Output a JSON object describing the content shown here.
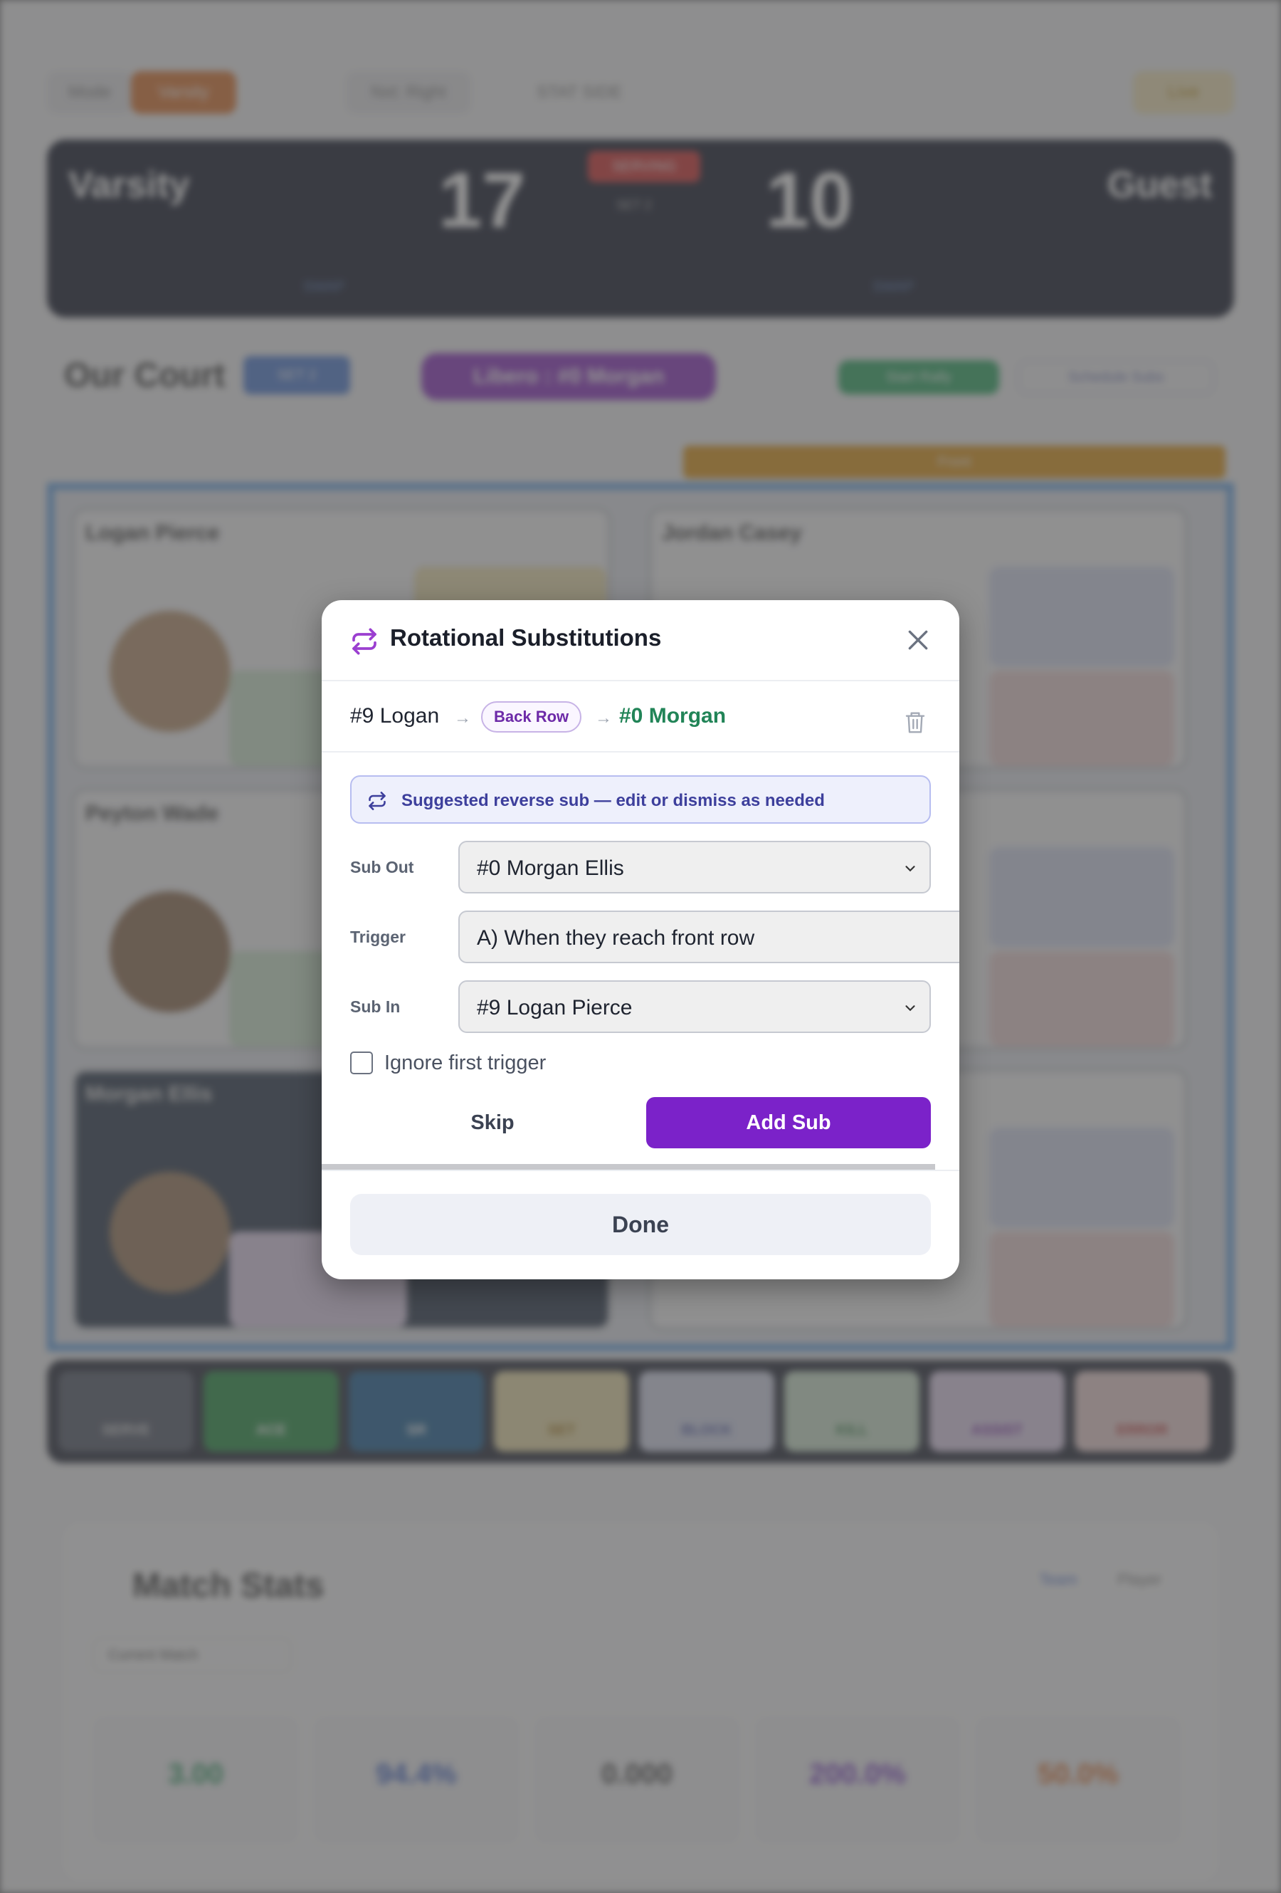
{
  "background": {
    "toolbar": {
      "mode_label": "Mode",
      "active_chip": "Varsity",
      "next_label": "Nxt: Right",
      "stat_label": "STAT SIDE",
      "badge": "Live"
    },
    "scoreboard": {
      "home_name": "Varsity",
      "home_score": "17",
      "away_name": "Guest",
      "away_score": "10",
      "serving": "SERVING",
      "set_label": "SET 2",
      "home_action": "SWAP",
      "away_action": "SWAP"
    },
    "court": {
      "title": "Our Court",
      "set_chip": "SET 2",
      "libero_chip": "Libero : #0 Morgan",
      "start_rally": "Start Rally",
      "schedule": "Schedule Subs",
      "zone_bar": "Front",
      "players": [
        "Logan Pierce",
        "Jordan Casey",
        "Peyton Wade",
        "Morgan Ellis"
      ]
    },
    "actions": [
      "SERVE",
      "ACE",
      "SR",
      "SET",
      "BLOCK",
      "KILL",
      "ASSIST",
      "ERROR"
    ],
    "stats": {
      "title": "Match Stats",
      "tab_team": "Team",
      "tab_player": "Player",
      "scope": "Current Match",
      "values": [
        "3.00",
        "94.4%",
        "0.000",
        "200.0%",
        "50.0%"
      ]
    }
  },
  "modal": {
    "title": "Rotational Substitutions",
    "close_icon": "close-icon",
    "sub": {
      "out": "#9 Logan",
      "badge": "Back Row",
      "in": "#0 Morgan"
    },
    "notice": "Suggested reverse sub — edit or dismiss as needed",
    "fields": {
      "sub_out_label": "Sub Out",
      "sub_out_value": "#0 Morgan Ellis",
      "trigger_label": "Trigger",
      "trigger_value": "A) When they reach front row",
      "sub_in_label": "Sub In",
      "sub_in_value": "#9 Logan Pierce"
    },
    "ignore_first": {
      "label": "Ignore first trigger",
      "checked": false
    },
    "skip": "Skip",
    "add_sub": "Add Sub",
    "done": "Done",
    "colors": {
      "accent": "#7b22c9",
      "sub_in": "#218457",
      "notice_bg": "#eef0fc"
    }
  }
}
